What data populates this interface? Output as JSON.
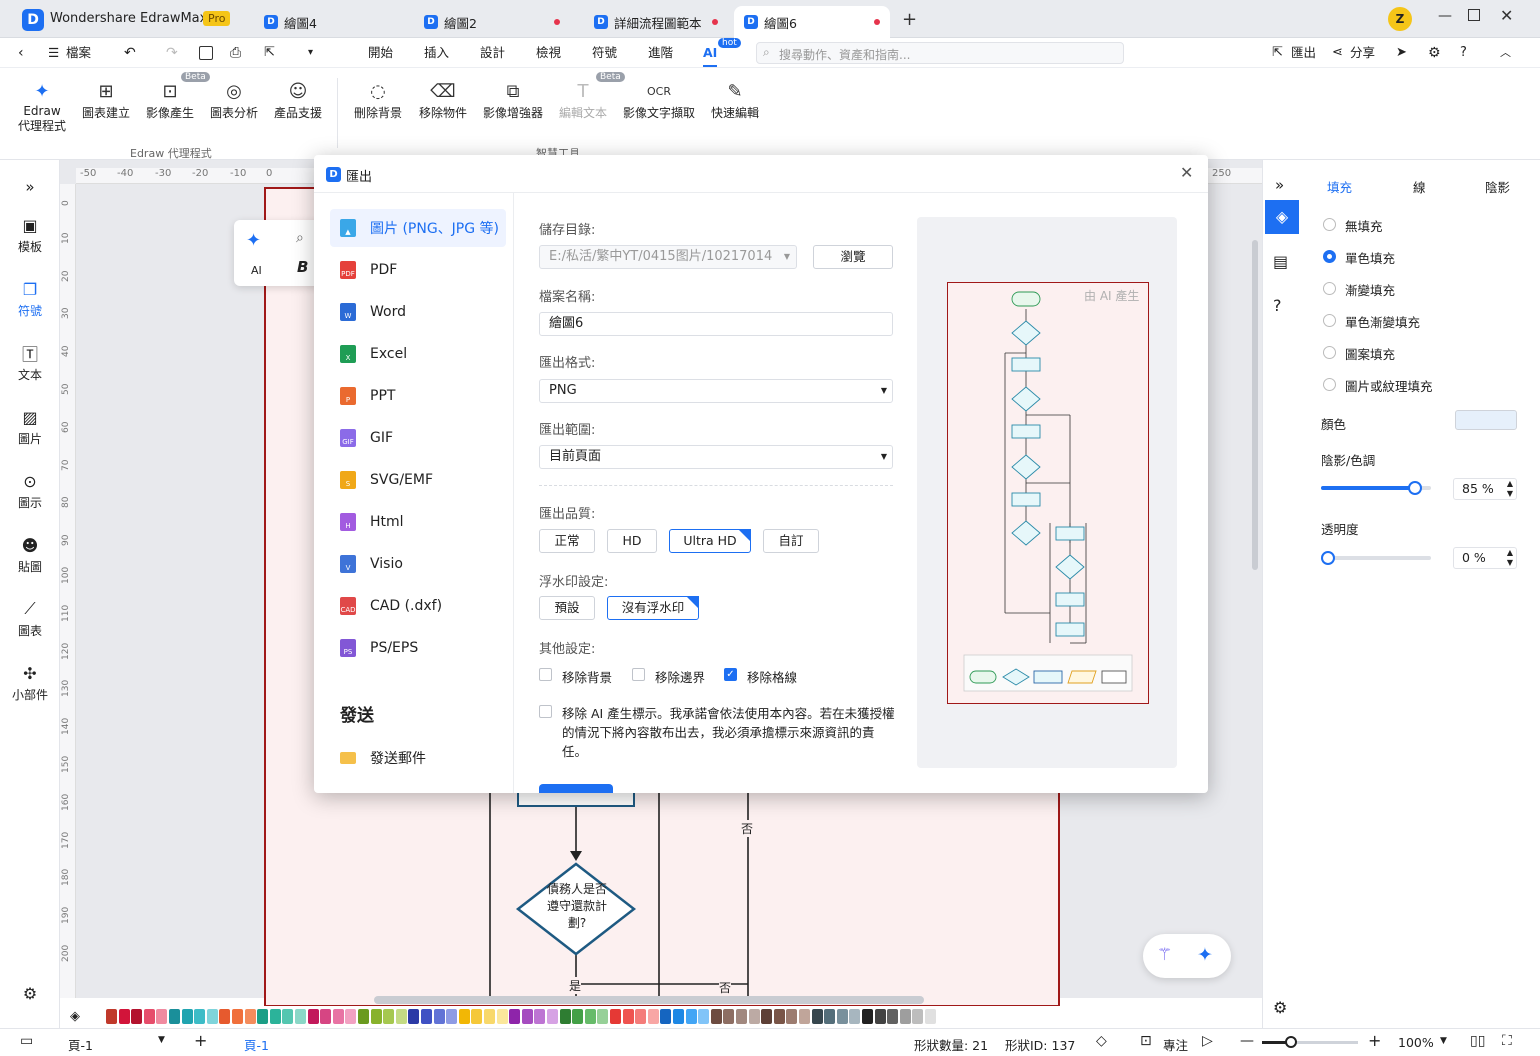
{
  "app": {
    "title": "Wondershare EdrawMax",
    "badge": "Pro",
    "user_initial": "Z"
  },
  "tabs": [
    {
      "label": "繪圖4"
    },
    {
      "label": "繪圖2"
    },
    {
      "label": "詳細流程圖範本"
    },
    {
      "label": "繪圖6"
    }
  ],
  "menubar": {
    "file": "檔案",
    "items": [
      "開始",
      "插入",
      "設計",
      "檢視",
      "符號",
      "進階",
      "AI"
    ],
    "ai_badge": "hot",
    "search_placeholder": "搜尋動作、資產和指南...",
    "export": "匯出",
    "share": "分享"
  },
  "ribbon": {
    "buttons": [
      {
        "label": "Edraw\n代理程式"
      },
      {
        "label": "圖表建立"
      },
      {
        "label": "影像產生",
        "badge": "Beta"
      },
      {
        "label": "圖表分析"
      },
      {
        "label": "產品支援"
      },
      {
        "label": "刪除背景"
      },
      {
        "label": "移除物件"
      },
      {
        "label": "影像增強器"
      },
      {
        "label": "編輯文本",
        "badge": "Beta",
        "disabled": true
      },
      {
        "label": "影像文字擷取"
      },
      {
        "label": "快速編輯"
      }
    ],
    "group1": "Edraw 代理程式",
    "group2": "智慧工具"
  },
  "leftbar": [
    "模板",
    "符號",
    "文本",
    "圖片",
    "圖示",
    "貼圖",
    "圖表",
    "小部件"
  ],
  "floating_ai": "AI",
  "ruler_h": [
    "-50",
    "-40",
    "-30",
    "-20",
    "-10",
    "0",
    "250"
  ],
  "ruler_v": [
    "0",
    "10",
    "20",
    "30",
    "40",
    "50",
    "60",
    "70",
    "80",
    "90",
    "100",
    "110",
    "120",
    "130",
    "140",
    "150",
    "160",
    "170",
    "180",
    "190",
    "200"
  ],
  "flowchart": {
    "decision": "債務人是否\n遵守還款計\n劃?",
    "no1": "否",
    "yes": "是",
    "no2": "否"
  },
  "rightpanel": {
    "tabs": [
      "填充",
      "線",
      "陰影"
    ],
    "fill_options": [
      "無填充",
      "單色填充",
      "漸變填充",
      "單色漸變填充",
      "圖案填充",
      "圖片或紋理填充"
    ],
    "selected_fill": "單色填充",
    "color_label": "顏色",
    "shade_label": "陰影/色調",
    "shade_value": "85 %",
    "shade_fraction": 0.85,
    "opacity_label": "透明度",
    "opacity_value": "0 %",
    "opacity_fraction": 0.0
  },
  "dialog": {
    "title": "匯出",
    "formats": [
      "圖片 (PNG、JPG 等)",
      "PDF",
      "Word",
      "Excel",
      "PPT",
      "GIF",
      "SVG/EMF",
      "Html",
      "Visio",
      "CAD (.dxf)",
      "PS/EPS"
    ],
    "send_header": "發送",
    "send_mail": "發送郵件",
    "save_dir_label": "儲存目錄:",
    "save_dir_value": "E:/私活/繁中YT/0415图片/10217014",
    "browse": "瀏覽",
    "filename_label": "檔案名稱:",
    "filename_value": "繪圖6",
    "format_label": "匯出格式:",
    "format_value": "PNG",
    "range_label": "匯出範圍:",
    "range_value": "目前頁面",
    "quality_label": "匯出品質:",
    "quality_options": [
      "正常",
      "HD",
      "Ultra HD",
      "自訂"
    ],
    "quality_selected": "Ultra HD",
    "watermark_label": "浮水印設定:",
    "watermark_options": [
      "預設",
      "沒有浮水印"
    ],
    "watermark_selected": "沒有浮水印",
    "other_label": "其他設定:",
    "other_options": [
      {
        "label": "移除背景",
        "checked": false
      },
      {
        "label": "移除邊界",
        "checked": false
      },
      {
        "label": "移除格線",
        "checked": true
      }
    ],
    "ai_remove_text": "移除 AI 產生標示。我承諾會依法使用本內容。若在未獲授權的情況下將內容散布出去，我必須承擔標示來源資訊的責任。",
    "ai_remove_checked": false,
    "preview_watermark": "由 AI 產生"
  },
  "statusbar": {
    "page_select": "頁-1",
    "page_tab": "頁-1",
    "shape_count": "形狀數量: 21",
    "shape_id": "形狀ID: 137",
    "focus": "專注",
    "zoom": "100%",
    "zoom_fraction": 0.3
  },
  "colors": {
    "accent": "#1d6ff2",
    "page_border": "#a01818",
    "page_fill": "#fcf0f0",
    "flow_stroke": "#1e5a82"
  },
  "palette": [
    "#c0392b",
    "#d2143a",
    "#b3122e",
    "#e64d6b",
    "#f08aa0",
    "#1a8f9a",
    "#20a4b0",
    "#3dbcc7",
    "#7fd4db",
    "#e65a2e",
    "#f0703c",
    "#f48c5c",
    "#1b9e86",
    "#2bb39a",
    "#54c6b0",
    "#8ad7c7",
    "#c2185b",
    "#d64583",
    "#e873a4",
    "#f2a1c2",
    "#6a9a1f",
    "#88b22c",
    "#a6c850",
    "#c4db84",
    "#2b3aa6",
    "#3f51c4",
    "#6173d6",
    "#8e9be4",
    "#f2b705",
    "#f5c83a",
    "#f8d86b",
    "#fbe79c",
    "#8e24aa",
    "#a54cc0",
    "#bd74d3",
    "#d6a2e4",
    "#2e7d32",
    "#43a047",
    "#66bb6a",
    "#96d098",
    "#e53935",
    "#ef5350",
    "#f47c7a",
    "#f8a6a5",
    "#1565c0",
    "#1e88e5",
    "#42a5f5",
    "#81c4f8",
    "#6d4c41",
    "#8d6e63",
    "#a1887f",
    "#bcaaa4",
    "#5d4037",
    "#795548",
    "#9c7c70",
    "#c0a59a",
    "#37474f",
    "#546e7a",
    "#78909c",
    "#a7b6bf",
    "#212121",
    "#424242",
    "#616161",
    "#9e9e9e",
    "#bdbdbd",
    "#e0e0e0"
  ]
}
